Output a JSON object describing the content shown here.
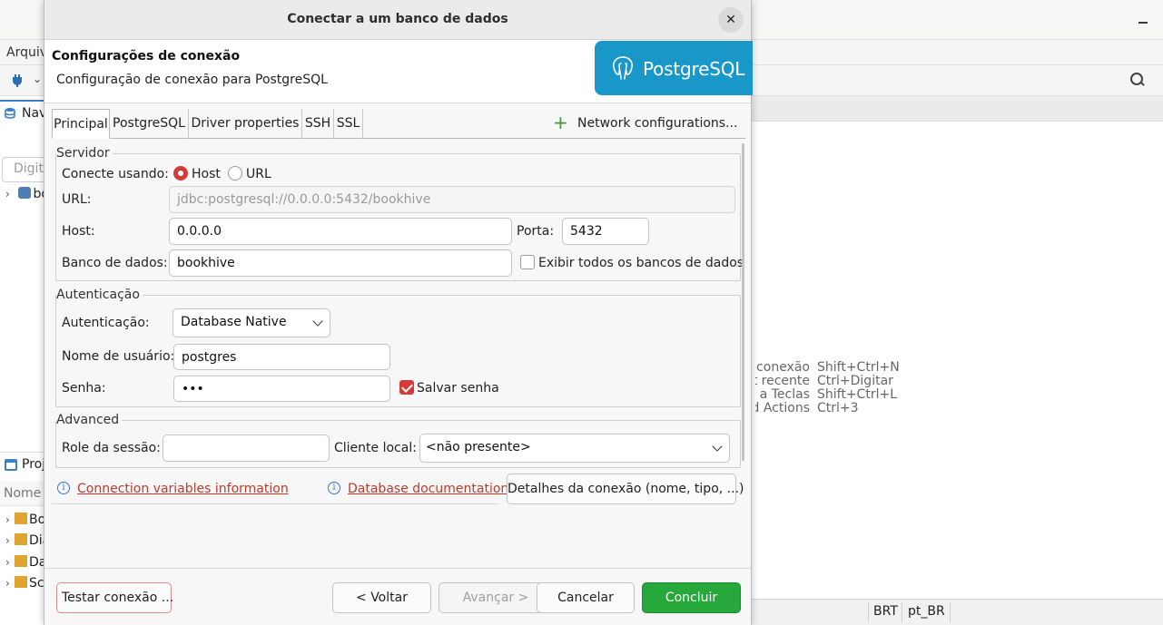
{
  "background": {
    "menu_item": "Arquivo",
    "nav_tab_label": "Navegador",
    "nav_filter_placeholder": "Digite",
    "nav_tree_item": "bookhive",
    "projects_tab_label": "Projetos",
    "projects_header": "Nome",
    "project_items": [
      "Bookmarks",
      "Diagramas",
      "Dados",
      "Scripts"
    ],
    "shortcuts": [
      {
        "name": "Nova conexão",
        "keys": "Shift+Ctrl+N"
      },
      {
        "name": "Script recente",
        "keys": "Ctrl+Digitar"
      },
      {
        "name": "Lista a Teclas",
        "keys": "Shift+Ctrl+L"
      },
      {
        "name": "Find Actions",
        "keys": "Ctrl+3"
      }
    ],
    "status_items": [
      "BRT",
      "pt_BR"
    ]
  },
  "dialog": {
    "title": "Conectar a um banco de dados",
    "header_title": "Configurações de conexão",
    "header_subtitle": "Configuração de conexão para PostgreSQL",
    "logo_text": "PostgreSQL",
    "tabs": [
      "Principal",
      "PostgreSQL",
      "Driver properties",
      "SSH",
      "SSL"
    ],
    "network_configurations": "Network configurations...",
    "server": {
      "legend": "Servidor",
      "connect_using_label": "Conecte usando:",
      "option_host": "Host",
      "option_url": "URL",
      "selected": "Host",
      "url_label": "URL:",
      "url_value": "jdbc:postgresql://0.0.0.0:5432/bookhive",
      "host_label": "Host:",
      "host_value": "0.0.0.0",
      "port_label": "Porta:",
      "port_value": "5432",
      "database_label": "Banco de dados:",
      "database_value": "bookhive",
      "show_all_databases_label": "Exibir todos os bancos de dados",
      "show_all_databases_checked": false
    },
    "auth": {
      "legend": "Autenticação",
      "auth_label": "Autenticação:",
      "auth_value": "Database Native",
      "username_label": "Nome de usuário:",
      "username_value": "postgres",
      "password_label": "Senha:",
      "password_value": "•••",
      "save_password_label": "Salvar senha",
      "save_password_checked": true
    },
    "advanced": {
      "legend": "Advanced",
      "session_role_label": "Role da sessão:",
      "session_role_value": "",
      "local_client_label": "Cliente local:",
      "local_client_value": "<não presente>"
    },
    "links": {
      "connection_variables": "Connection variables information",
      "database_documentation": "Database documentation",
      "connection_details_button": "Detalhes da conexão (nome, tipo, ...)"
    },
    "buttons": {
      "test": "Testar conexão ...",
      "back": "< Voltar",
      "next": "Avançar >",
      "cancel": "Cancelar",
      "finish": "Concluir"
    },
    "colors": {
      "accent": "#d33b3b",
      "primary_button": "#27a83b",
      "logo_background": "#1997c8",
      "link": "#c0392b"
    }
  }
}
